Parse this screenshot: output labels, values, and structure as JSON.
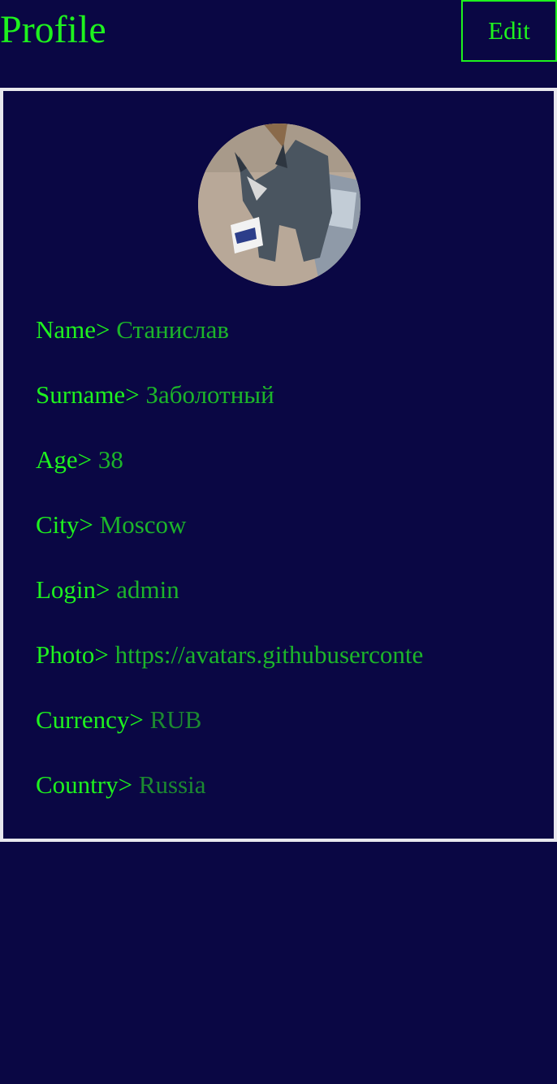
{
  "header": {
    "title": "Profile",
    "edit_label": "Edit"
  },
  "profile": {
    "fields": [
      {
        "label": "Name>",
        "value": "Станислав"
      },
      {
        "label": "Surname>",
        "value": "Заболотный"
      },
      {
        "label": "Age>",
        "value": "38"
      },
      {
        "label": "City>",
        "value": "Moscow"
      },
      {
        "label": "Login>",
        "value": "admin"
      },
      {
        "label": "Photo>",
        "value": "https://avatars.githubuserconte"
      },
      {
        "label": "Currency>",
        "value": "RUB"
      },
      {
        "label": "Country>",
        "value": "Russia"
      }
    ]
  },
  "colors": {
    "background": "#0a0744",
    "accent": "#1ef21e",
    "value_text": "#1cb52a",
    "card_border": "#e8e8ee"
  }
}
